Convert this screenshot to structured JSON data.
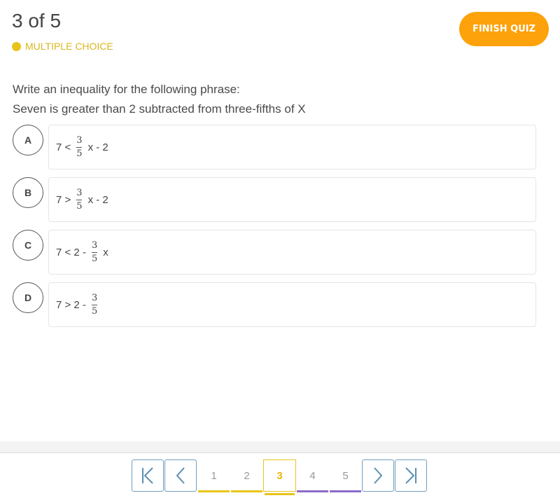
{
  "header": {
    "counter": "3 of 5",
    "question_type": "MULTIPLE CHOICE",
    "finish_label": "FINISH QUIZ"
  },
  "question": {
    "line1": "Write an inequality for the following phrase:",
    "line2": "Seven is greater than 2 subtracted from three-fifths of X"
  },
  "options": [
    {
      "letter": "A",
      "before": "7 <",
      "num": "3",
      "den": "5",
      "after": "x - 2"
    },
    {
      "letter": "B",
      "before": "7 >",
      "num": "3",
      "den": "5",
      "after": "x - 2"
    },
    {
      "letter": "C",
      "before": "7 < 2 -",
      "num": "3",
      "den": "5",
      "after": "x"
    },
    {
      "letter": "D",
      "before": "7 > 2 -",
      "num": "3",
      "den": "5",
      "after": ""
    }
  ],
  "pagination": {
    "first_icon": "first-page-icon",
    "prev_icon": "previous-page-icon",
    "next_icon": "next-page-icon",
    "last_icon": "last-page-icon",
    "pages": [
      {
        "label": "1",
        "status_color": "#e8c41a"
      },
      {
        "label": "2",
        "status_color": "#e8c41a"
      },
      {
        "label": "3",
        "status_color": "#e8c41a",
        "current": true
      },
      {
        "label": "4",
        "status_color": "#8a6bc9"
      },
      {
        "label": "5",
        "status_color": "#8a6bc9"
      }
    ]
  },
  "colors": {
    "accent": "#fda20a",
    "answered": "#e8c41a",
    "unanswered": "#8a6bc9",
    "nav": "#5a8fb3"
  }
}
